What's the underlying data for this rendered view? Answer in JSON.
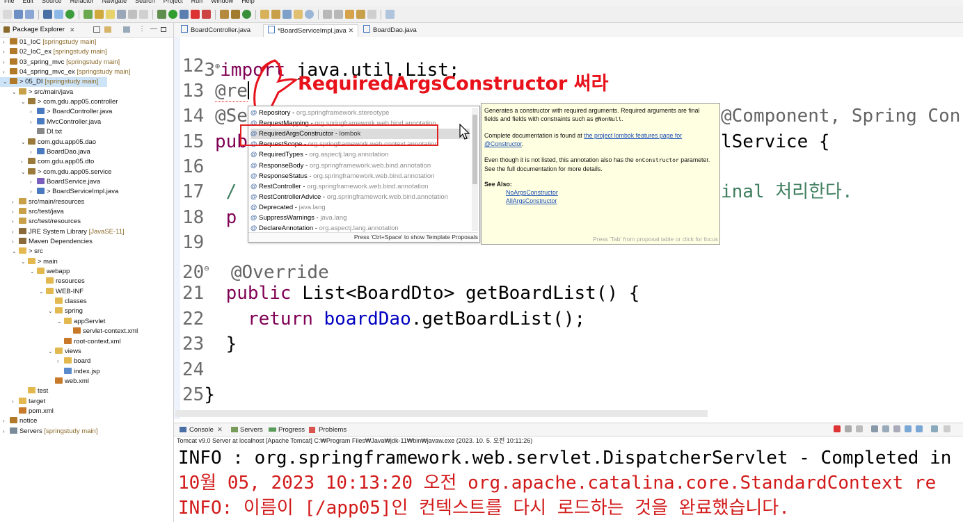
{
  "menu": [
    "File",
    "Edit",
    "Source",
    "Refactor",
    "Navigate",
    "Search",
    "Project",
    "Run",
    "Window",
    "Help"
  ],
  "explorer": {
    "tab_label": "Package Explorer",
    "items": [
      {
        "label": "01_IoC",
        "dec": "[springstudy main]",
        "depth": 0,
        "arrow": "›",
        "icon": "project-icon"
      },
      {
        "label": "02_IoC_ex",
        "dec": "[springstudy main]",
        "depth": 0,
        "arrow": "›",
        "icon": "project-icon"
      },
      {
        "label": "03_spring_mvc",
        "dec": "[springstudy main]",
        "depth": 0,
        "arrow": "›",
        "icon": "project-icon"
      },
      {
        "label": "04_spring_mvc_ex",
        "dec": "[springstudy main]",
        "depth": 0,
        "arrow": "›",
        "icon": "project-icon"
      },
      {
        "label": "> 05_DI",
        "dec": "[springstudy main]",
        "depth": 0,
        "arrow": "⌄",
        "icon": "project-icon",
        "selected": true
      },
      {
        "label": "> src/main/java",
        "dec": "",
        "depth": 1,
        "arrow": "⌄",
        "icon": "source-folder-icon"
      },
      {
        "label": "> com.gdu.app05.controller",
        "dec": "",
        "depth": 2,
        "arrow": "⌄",
        "icon": "package-icon"
      },
      {
        "label": "> BoardController.java",
        "dec": "",
        "depth": 3,
        "arrow": "›",
        "icon": "java-file-icon"
      },
      {
        "label": "MvcController.java",
        "dec": "",
        "depth": 3,
        "arrow": "›",
        "icon": "java-file-icon"
      },
      {
        "label": "DI.txt",
        "dec": "",
        "depth": 3,
        "arrow": "",
        "icon": "text-file-icon"
      },
      {
        "label": "com.gdu.app05.dao",
        "dec": "",
        "depth": 2,
        "arrow": "⌄",
        "icon": "package-icon"
      },
      {
        "label": "BoardDao.java",
        "dec": "",
        "depth": 3,
        "arrow": "›",
        "icon": "java-file-icon"
      },
      {
        "label": "com.gdu.app05.dto",
        "dec": "",
        "depth": 2,
        "arrow": "›",
        "icon": "package-icon"
      },
      {
        "label": "> com.gdu.app05.service",
        "dec": "",
        "depth": 2,
        "arrow": "⌄",
        "icon": "package-icon"
      },
      {
        "label": "BoardService.java",
        "dec": "",
        "depth": 3,
        "arrow": "›",
        "icon": "java-interface-icon"
      },
      {
        "label": "> BoardServiceImpl.java",
        "dec": "",
        "depth": 3,
        "arrow": "›",
        "icon": "java-file-icon"
      },
      {
        "label": "src/main/resources",
        "dec": "",
        "depth": 1,
        "arrow": "›",
        "icon": "source-folder-icon"
      },
      {
        "label": "src/test/java",
        "dec": "",
        "depth": 1,
        "arrow": "›",
        "icon": "source-folder-icon"
      },
      {
        "label": "src/test/resources",
        "dec": "",
        "depth": 1,
        "arrow": "›",
        "icon": "source-folder-icon"
      },
      {
        "label": "JRE System Library",
        "dec": "[JavaSE-11]",
        "depth": 1,
        "arrow": "›",
        "icon": "library-icon"
      },
      {
        "label": "Maven Dependencies",
        "dec": "",
        "depth": 1,
        "arrow": "›",
        "icon": "library-icon"
      },
      {
        "label": "> src",
        "dec": "",
        "depth": 1,
        "arrow": "⌄",
        "icon": "folder-icon"
      },
      {
        "label": "> main",
        "dec": "",
        "depth": 2,
        "arrow": "⌄",
        "icon": "folder-icon"
      },
      {
        "label": "webapp",
        "dec": "",
        "depth": 3,
        "arrow": "⌄",
        "icon": "folder-icon"
      },
      {
        "label": "resources",
        "dec": "",
        "depth": 4,
        "arrow": "",
        "icon": "folder-icon"
      },
      {
        "label": "WEB-INF",
        "dec": "",
        "depth": 4,
        "arrow": "⌄",
        "icon": "folder-icon"
      },
      {
        "label": "classes",
        "dec": "",
        "depth": 5,
        "arrow": "",
        "icon": "folder-icon"
      },
      {
        "label": "spring",
        "dec": "",
        "depth": 5,
        "arrow": "⌄",
        "icon": "folder-icon"
      },
      {
        "label": "appServlet",
        "dec": "",
        "depth": 6,
        "arrow": "⌄",
        "icon": "folder-icon"
      },
      {
        "label": "servlet-context.xml",
        "dec": "",
        "depth": 7,
        "arrow": "",
        "icon": "xml-file-icon"
      },
      {
        "label": "root-context.xml",
        "dec": "",
        "depth": 6,
        "arrow": "",
        "icon": "xml-file-icon"
      },
      {
        "label": "views",
        "dec": "",
        "depth": 5,
        "arrow": "⌄",
        "icon": "folder-icon"
      },
      {
        "label": "board",
        "dec": "",
        "depth": 6,
        "arrow": "›",
        "icon": "folder-icon"
      },
      {
        "label": "index.jsp",
        "dec": "",
        "depth": 6,
        "arrow": "",
        "icon": "jsp-file-icon"
      },
      {
        "label": "web.xml",
        "dec": "",
        "depth": 5,
        "arrow": "",
        "icon": "xml-file-icon"
      },
      {
        "label": "test",
        "dec": "",
        "depth": 2,
        "arrow": "",
        "icon": "folder-icon"
      },
      {
        "label": "target",
        "dec": "",
        "depth": 1,
        "arrow": "›",
        "icon": "folder-icon"
      },
      {
        "label": "pom.xml",
        "dec": "",
        "depth": 1,
        "arrow": "",
        "icon": "xml-file-icon"
      },
      {
        "label": "notice",
        "dec": "",
        "depth": 0,
        "arrow": "›",
        "icon": "project-icon"
      },
      {
        "label": "Servers",
        "dec": "[springstudy main]",
        "depth": 0,
        "arrow": "›",
        "icon": "servers-icon"
      }
    ]
  },
  "editor": {
    "tabs": [
      {
        "label": "BoardController.java",
        "active": false
      },
      {
        "label": "*BoardServiceImpl.java",
        "active": true
      },
      {
        "label": "BoardDao.java",
        "active": false
      }
    ],
    "lines": {
      "l3": {
        "num": "3",
        "fold": "⊕",
        "kw": "import",
        "rest": " java.util.List;"
      },
      "l12": {
        "num": "12"
      },
      "l13": {
        "num": "13",
        "text": "@re"
      },
      "l14": {
        "num": "14",
        "text": "@Se",
        "right": "@Component, Spring Con"
      },
      "l15": {
        "num": "15",
        "text": "pub",
        "right": "lService {"
      },
      "l16": {
        "num": "16"
      },
      "l17": {
        "num": "17",
        "text": "/",
        "right": "inal 처리한다."
      },
      "l18": {
        "num": "18",
        "text": "p"
      },
      "l19": {
        "num": "19"
      },
      "l20": {
        "num": "20",
        "fold": "⊖",
        "text": "@Override"
      },
      "l21": {
        "num": "21",
        "kw": "public",
        "rest": " List<BoardDto> getBoardList() {"
      },
      "l22": {
        "num": "22",
        "kw": "return",
        "field": "boardDao",
        "rest": ".getBoardList();"
      },
      "l23": {
        "num": "23",
        "text": "}"
      },
      "l24": {
        "num": "24"
      },
      "l25": {
        "num": "25",
        "text": "}"
      }
    }
  },
  "annotation": {
    "text": "RequiredArgsConstructor 써라",
    "color": "#e8121b"
  },
  "completion": {
    "items": [
      {
        "name": "Repository",
        "pkg": "org.springframework.stereotype"
      },
      {
        "name": "RequestMapping",
        "pkg": "org.springframework.web.bind.annotation"
      },
      {
        "name": "RequiredArgsConstructor",
        "pkg": "lombok",
        "highlighted": true
      },
      {
        "name": "RequestScope",
        "pkg": "org.springframework.web.context.annotation"
      },
      {
        "name": "RequiredTypes",
        "pkg": "org.aspectj.lang.annotation"
      },
      {
        "name": "ResponseBody",
        "pkg": "org.springframework.web.bind.annotation"
      },
      {
        "name": "ResponseStatus",
        "pkg": "org.springframework.web.bind.annotation"
      },
      {
        "name": "RestController",
        "pkg": "org.springframework.web.bind.annotation"
      },
      {
        "name": "RestControllerAdvice",
        "pkg": "org.springframework.web.bind.annotation"
      },
      {
        "name": "Deprecated",
        "pkg": "java.lang"
      },
      {
        "name": "SuppressWarnings",
        "pkg": "java.lang"
      },
      {
        "name": "DeclareAnnotation",
        "pkg": "org.aspectj.lang.annotation"
      }
    ],
    "footer": "Press 'Ctrl+Space' to show Template Proposals"
  },
  "doc": {
    "p1_a": "Generates a constructor with required arguments. Required arguments are final fields and fields with constraints such as ",
    "p1_code": "@NonNull",
    "p1_b": ".",
    "p2_a": "Complete documentation is found at ",
    "p2_link": "the project lombok features page for @Constructor",
    "p2_b": ".",
    "p3_a": "Even though it is not listed, this annotation also has the ",
    "p3_code": "onConstructor",
    "p3_b": " parameter. See the full documentation for more details.",
    "see_also": "See Also:",
    "links": [
      "NoArgsConstructor",
      "AllArgsConstructor"
    ],
    "footer": "Press 'Tab' from proposal table or click for focus"
  },
  "console": {
    "tabs": [
      "Console",
      "Servers",
      "Progress",
      "Problems"
    ],
    "description": "Tomcat v9.0 Server at localhost [Apache Tomcat] C:₩Program Files₩Java₩jdk-11₩bin₩javaw.exe  (2023. 10. 5. 오전 10:11:26)",
    "lines": [
      {
        "text": "INFO : org.springframework.web.servlet.DispatcherServlet - Completed in",
        "color": "black"
      },
      {
        "text": "10월 05, 2023 10:13:20 오전 org.apache.catalina.core.StandardContext re",
        "color": "red"
      },
      {
        "text": "INFO: 이름이 [/app05]인 컨텍스트를 다시 로드하는 것을 완료했습니다.",
        "color": "red"
      }
    ]
  }
}
